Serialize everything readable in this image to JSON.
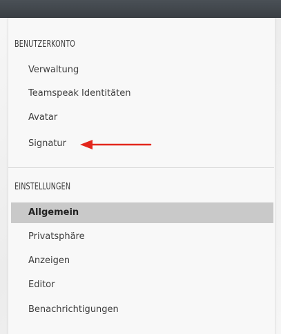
{
  "sections": [
    {
      "header": "BENUTZERKONTO",
      "items": [
        {
          "label": "Verwaltung"
        },
        {
          "label": "Teamspeak Identitäten"
        },
        {
          "label": "Avatar"
        },
        {
          "label": "Signatur"
        }
      ]
    },
    {
      "header": "EINSTELLUNGEN",
      "items": [
        {
          "label": "Allgemein",
          "active": true
        },
        {
          "label": "Privatsphäre"
        },
        {
          "label": "Anzeigen"
        },
        {
          "label": "Editor"
        },
        {
          "label": "Benachrichtigungen"
        }
      ]
    }
  ],
  "colors": {
    "top_bar": "#3f444a",
    "active_item_bg": "#c9c9c9",
    "arrow": "#e3261c"
  },
  "annotation": {
    "icon": "red-arrow-left-icon"
  }
}
